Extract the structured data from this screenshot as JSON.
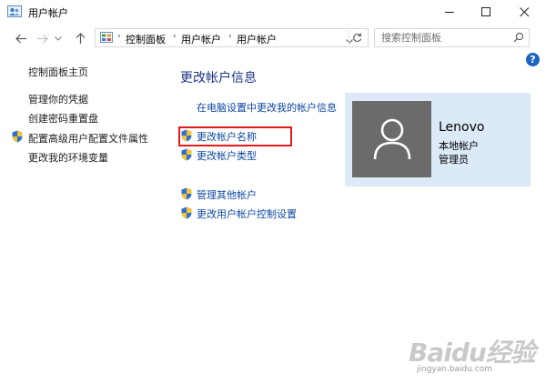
{
  "window": {
    "title": "用户帐户"
  },
  "address_bar": {
    "breadcrumb": [
      "控制面板",
      "用户帐户",
      "用户帐户"
    ],
    "separator": "›",
    "search_placeholder": "搜索控制面板"
  },
  "help": {
    "label": "?"
  },
  "sidebar": {
    "home": "控制面板主页",
    "items": [
      {
        "label": "管理你的凭据",
        "shield": false
      },
      {
        "label": "创建密码重置盘",
        "shield": false
      },
      {
        "label": "配置高级用户配置文件属性",
        "shield": true
      },
      {
        "label": "更改我的环境变量",
        "shield": false
      }
    ]
  },
  "main": {
    "title": "更改帐户信息",
    "tasks": [
      {
        "label": "在电脑设置中更改我的帐户信息",
        "shield": false
      },
      {
        "label": "更改帐户名称",
        "shield": true,
        "highlighted": true
      },
      {
        "label": "更改帐户类型",
        "shield": true
      },
      {
        "label": "管理其他帐户",
        "shield": true
      },
      {
        "label": "更改用户帐户控制设置",
        "shield": true
      }
    ]
  },
  "user": {
    "name": "Lenovo",
    "type": "本地帐户",
    "role": "管理员"
  },
  "watermark": {
    "logo": "Baidu经验",
    "url": "jingyan.baidu.com"
  },
  "colors": {
    "link": "#0d47a1",
    "title": "#1e3287",
    "highlight": "#e01b1b",
    "card_bg": "#dceaf8",
    "avatar_bg": "#6b6b6b"
  },
  "icons": {
    "titlebar": "user-accounts-icon",
    "shield": "uac-shield-icon",
    "avatar": "user-silhouette-icon"
  }
}
